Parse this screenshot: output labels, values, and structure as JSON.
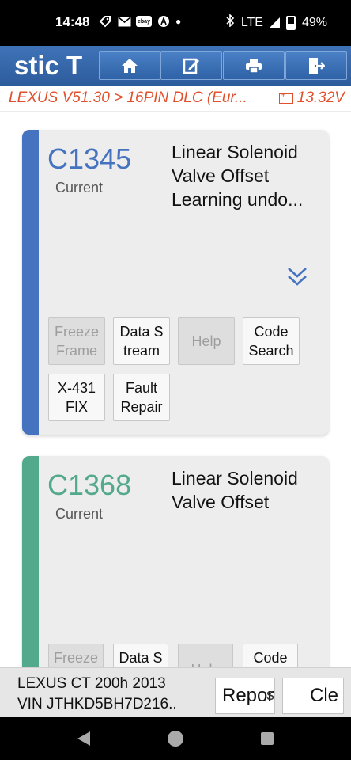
{
  "status_bar": {
    "time": "14:48",
    "ebay": "ebay",
    "network": "LTE",
    "battery": "49%"
  },
  "toolbar": {
    "title": "stic T",
    "buttons": [
      {
        "icon": "home-icon"
      },
      {
        "icon": "edit-report-icon"
      },
      {
        "icon": "print-icon"
      },
      {
        "icon": "exit-icon"
      }
    ],
    "colors": {
      "bar": "#2d5c9c",
      "button": "#3f73b8"
    }
  },
  "breadcrumb": {
    "path": "LEXUS V51.30 > 16PIN DLC (Eur...",
    "voltage": "13.32V",
    "color": "#e0502c"
  },
  "dtcs": [
    {
      "code": "C1345",
      "status": "Current",
      "description": [
        "Linear Solenoid",
        "Valve Offset",
        "Learning undo..."
      ],
      "accent": "#4673bf",
      "buttons": [
        {
          "label": [
            "Freeze",
            "Frame"
          ],
          "enabled": false
        },
        {
          "label": [
            "Data S",
            "tream"
          ],
          "enabled": true
        },
        {
          "label": [
            "Help"
          ],
          "enabled": false
        },
        {
          "label": [
            "Code",
            "Search"
          ],
          "enabled": true
        },
        {
          "label": [
            "X-431",
            "FIX"
          ],
          "enabled": true
        },
        {
          "label": [
            "Fault",
            "Repair"
          ],
          "enabled": true
        }
      ]
    },
    {
      "code": "C1368",
      "status": "Current",
      "description": [
        "Linear Solenoid",
        "Valve Offset"
      ],
      "accent": "#52a98c",
      "buttons": [
        {
          "label": [
            "Freeze"
          ],
          "enabled": false
        },
        {
          "label": [
            "Data S"
          ],
          "enabled": true
        },
        {
          "label": [
            "Help"
          ],
          "enabled": false
        },
        {
          "label": [
            "Code"
          ],
          "enabled": true
        }
      ]
    }
  ],
  "vehicle": {
    "model": "LEXUS CT 200h 2013",
    "vin": "VIN JTHKD5BH7D216.."
  },
  "footer_buttons": {
    "report": "Repor",
    "fragment": "s",
    "clear": "Cle"
  }
}
